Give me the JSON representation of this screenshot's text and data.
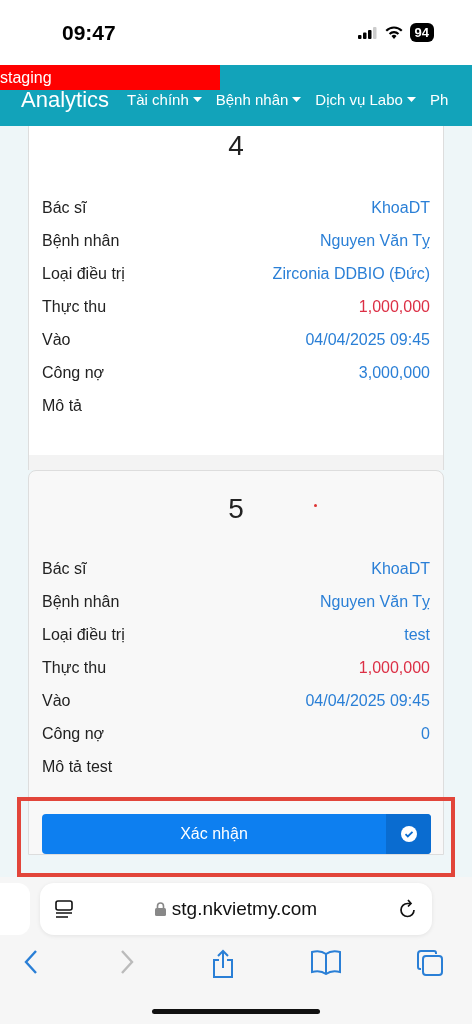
{
  "status_bar": {
    "time": "09:47",
    "battery": "94"
  },
  "env_banner": {
    "label": "staging"
  },
  "navbar": {
    "brand": "Analytics",
    "items": [
      {
        "label": "Tài chính",
        "dropdown": true
      },
      {
        "label": "Bệnh nhân",
        "dropdown": true
      },
      {
        "label": "Dịch vụ Labo",
        "dropdown": true
      },
      {
        "label": "Ph",
        "dropdown": false
      }
    ]
  },
  "cards": [
    {
      "number": "4",
      "rows": [
        {
          "label": "Bác sĩ",
          "value": "KhoaDT",
          "color": "#2a7fd6"
        },
        {
          "label": "Bệnh nhân",
          "value": "Nguyen Văn Tỵ",
          "color": "#2a7fd6"
        },
        {
          "label": "Loại điều trị",
          "value": "Zirconia DDBIO (Đức)",
          "color": "#2a7fd6"
        },
        {
          "label": "Thực thu",
          "value": "1,000,000",
          "color": "#dc2f45"
        },
        {
          "label": "Vào",
          "value": "04/04/2025 09:45",
          "color": "#2a7fd6"
        },
        {
          "label": "Công nợ",
          "value": "3,000,000",
          "color": "#2a7fd6"
        },
        {
          "label": "Mô tả"
        }
      ]
    },
    {
      "number": "5",
      "rows": [
        {
          "label": "Bác sĩ",
          "value": "KhoaDT",
          "color": "#2a7fd6"
        },
        {
          "label": "Bệnh nhân",
          "value": "Nguyen Văn Tỵ",
          "color": "#2a7fd6"
        },
        {
          "label": "Loại điều trị",
          "value": "test",
          "color": "#2a7fd6"
        },
        {
          "label": "Thực thu",
          "value": "1,000,000",
          "color": "#dc2f45"
        },
        {
          "label": "Vào",
          "value": "04/04/2025 09:45",
          "color": "#2a7fd6"
        },
        {
          "label": "Công nợ",
          "value": "0",
          "color": "#2a7fd6"
        },
        {
          "label": "Mô tả test"
        }
      ],
      "confirm_button": {
        "label": "Xác nhận"
      }
    }
  ],
  "browser": {
    "url": "stg.nkvietmy.com",
    "forward_disabled": true
  }
}
